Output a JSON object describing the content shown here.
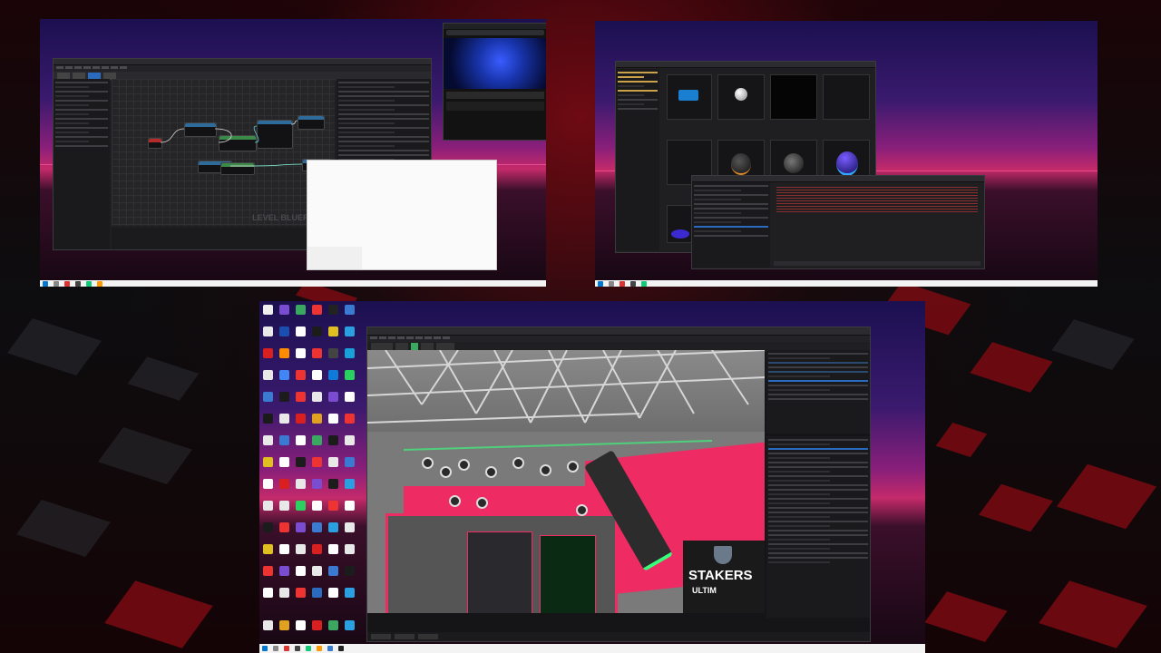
{
  "monitors": [
    {
      "id": "top-left",
      "content": "Unreal Editor level blueprint and browser window"
    },
    {
      "id": "top-right",
      "content": "Content browser and output log"
    },
    {
      "id": "bottom",
      "content": "Desktop icons and Unreal Editor viewport"
    }
  ],
  "blueprint": {
    "watermark": "LEVEL BLUEPRINT"
  },
  "viewport": {
    "banner_line1": "STAKERS",
    "banner_line2": "ULTIM"
  },
  "colors": {
    "accent_pink": "#ef2b63",
    "background_red": "#7a0a12",
    "editor_dark": "#1f1f22"
  }
}
